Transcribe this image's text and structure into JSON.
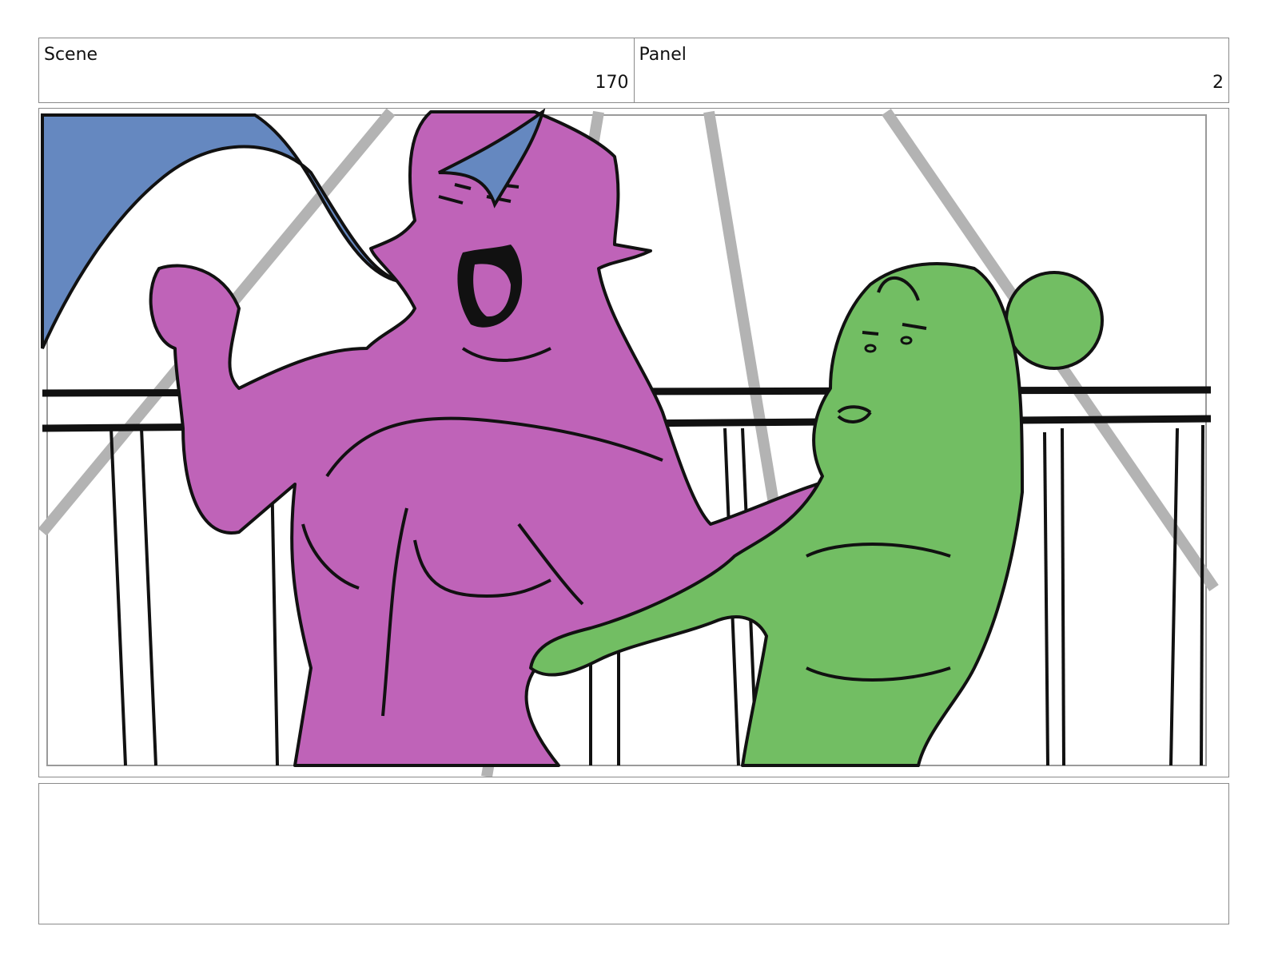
{
  "header": {
    "scene_label": "Scene",
    "scene_value": "170",
    "panel_label": "Panel",
    "panel_value": "2"
  },
  "panel_art": {
    "colors": {
      "left_character": "#bf63b8",
      "right_character": "#72be63",
      "sky_shape": "#6588c0",
      "light_beams": "#b3b3b3",
      "ink": "#111111"
    }
  },
  "notes": {
    "text": ""
  }
}
